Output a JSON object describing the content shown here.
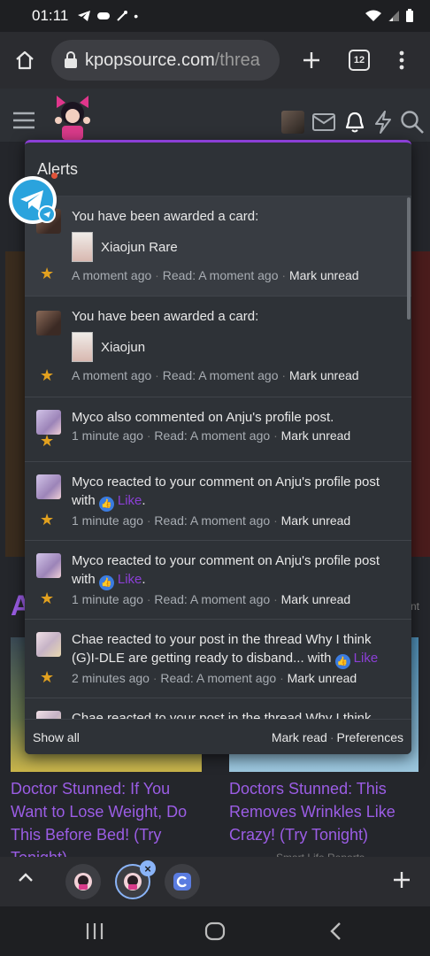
{
  "status_bar": {
    "time": "01:11",
    "dot": "•"
  },
  "browser": {
    "url_main": "kpopsource.com",
    "url_tail": "/threa",
    "tab_count": "12"
  },
  "alerts": {
    "title": "Alerts",
    "items": [
      {
        "text": "You have been awarded a card:",
        "card": "Xiaojun Rare",
        "time": "A moment ago",
        "read_label": "Read:",
        "read_time": "A moment ago",
        "action": "Mark unread"
      },
      {
        "text": "You have been awarded a card:",
        "card": "Xiaojun",
        "time": "A moment ago",
        "read_label": "Read:",
        "read_time": "A moment ago",
        "action": "Mark unread"
      },
      {
        "text": "Myco also commented on Anju's profile post.",
        "time": "1 minute ago",
        "read_label": "Read:",
        "read_time": "A moment ago",
        "action": "Mark unread"
      },
      {
        "text": "Myco reacted to your comment on Anju's profile post with",
        "reaction": "Like",
        "end": ".",
        "time": "1 minute ago",
        "read_label": "Read:",
        "read_time": "A moment ago",
        "action": "Mark unread"
      },
      {
        "text": "Myco reacted to your comment on Anju's profile post with",
        "reaction": "Like",
        "end": ".",
        "time": "1 minute ago",
        "read_label": "Read:",
        "read_time": "A moment ago",
        "action": "Mark unread"
      },
      {
        "text": "Chae reacted to your post in the thread Why I think (G)I-DLE are getting ready to disband... with",
        "reaction": "Like",
        "time": "2 minutes ago",
        "read_label": "Read:",
        "read_time": "A moment ago",
        "action": "Mark unread"
      },
      {
        "text": "Chae reacted to your post in the thread Why I think"
      }
    ],
    "footer": {
      "show_all": "Show all",
      "mark_read": "Mark read",
      "preferences": "Preferences"
    }
  },
  "background": {
    "section_letter": "A",
    "section_tail": "nt",
    "ad_left": "Doctor Stunned: If You Want to Lose Weight, Do This Before Bed! (Try Tonight)",
    "ad_right": "Doctors Stunned: This Removes Wrinkles Like Crazy! (Try Tonight)",
    "ad_right_source": "Smart Life Reports"
  },
  "colors": {
    "accent": "#8b3fd6",
    "star": "#e2a11f",
    "like": "#3b7ce0",
    "link_purple": "#9b5de5"
  }
}
